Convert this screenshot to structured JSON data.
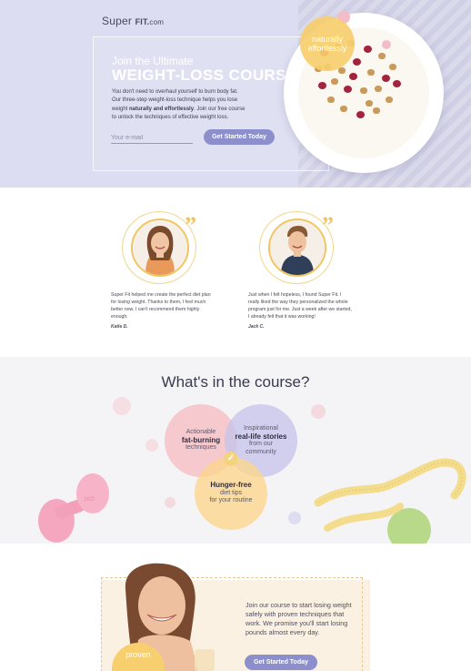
{
  "brand": {
    "name_light": "Super",
    "name_bold": "FIT.",
    "name_tld": "com"
  },
  "hero": {
    "pretitle": "Join the Ultimate",
    "title": "WEIGHT-LOSS COURSE",
    "text_1": "You don't need to overhaul yourself to burn body fat. Our three-step weight-loss technique helps you lose weight ",
    "text_bold": "naturally and effortlessly",
    "text_2": ". Join our free course to unlock the techniques of effective weight loss.",
    "email_placeholder": "Your e-mail",
    "cta_label": "Get Started Today",
    "badge_line1": "naturally",
    "badge_line2": "effortlessly"
  },
  "testimonials": [
    {
      "quote": "Super Fit helped me create the perfect diet plan for losing weight. Thanks to them, I feel much better now. I can't recommend them highly enough.",
      "author": "Katie D."
    },
    {
      "quote": "Just when I felt hopeless, I found Super Fit. I really liked the way they personalized the whole program just for me. Just a week after we started, I already felt that it was working!",
      "author": "Jack C."
    }
  ],
  "course": {
    "title": "What's in the course?",
    "bubbles": [
      {
        "line1": "Actionable",
        "bold": "fat-burning",
        "line2": "techniques"
      },
      {
        "line1": "Inspirational",
        "bold": "real-life stories",
        "line2": "from our",
        "line3": "community"
      },
      {
        "bold": "Hunger-free",
        "line1": "diet tips",
        "line2": "for your routine"
      }
    ],
    "dumbbell_label": "1KG"
  },
  "cta": {
    "text": "Join our course to start losing weight safely with proven techniques that work. We promise you'll start losing pounds almost every day.",
    "button_label": "Get Started Today",
    "badge": "proven"
  },
  "colors": {
    "hero_bg": "#dcdcf2",
    "accent_purple": "#8c8fcc",
    "accent_yellow": "#f7cf6e",
    "accent_pink": "#f5b8be",
    "cta_bg": "#fbf1e3"
  }
}
